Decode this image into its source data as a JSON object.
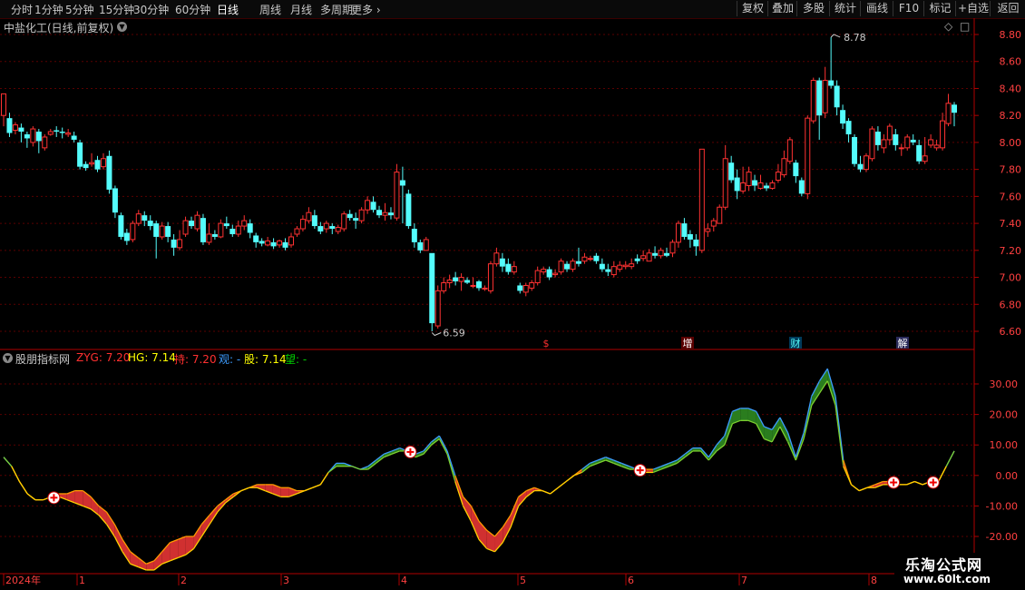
{
  "toolbar": {
    "tabs": [
      "分时",
      "1分钟",
      "5分钟",
      "15分钟",
      "30分钟",
      "60分钟",
      "日线",
      "周线",
      "月线",
      "多周期",
      "更多"
    ],
    "active_tab": "日线",
    "buttons": [
      "复权",
      "叠加",
      "多股",
      "统计",
      "画线",
      "F10",
      "标记",
      "+自选",
      "返回"
    ]
  },
  "main_title": "中盐化工(日线,前复权)",
  "indicator": {
    "name": "股朋指标网",
    "fields": [
      {
        "label": "ZYG: 7.20",
        "color": "#ff3030"
      },
      {
        "label": "HG: 7.14",
        "color": "#ffff00"
      },
      {
        "label": "持: 7.20",
        "color": "#ff3030"
      },
      {
        "label": "观: -",
        "color": "#3c9cff"
      },
      {
        "label": "股: 7.14",
        "color": "#ffff00"
      },
      {
        "label": "望: -",
        "color": "#00d000"
      }
    ]
  },
  "price_axis": [
    "8.80",
    "8.60",
    "8.40",
    "8.20",
    "8.00",
    "7.80",
    "7.60",
    "7.40",
    "7.20",
    "7.00",
    "6.80",
    "6.60"
  ],
  "ind_axis": [
    "30.00",
    "20.00",
    "10.00",
    "0.00",
    "-10.00",
    "-20.00"
  ],
  "annotations": {
    "high": "8.78",
    "low": "6.59"
  },
  "events": [
    "$",
    "增",
    "财",
    "解"
  ],
  "time_axis": [
    "2024年",
    "1",
    "2",
    "3",
    "4",
    "5",
    "6",
    "7",
    "8"
  ],
  "watermark": {
    "line1": "乐淘公式网",
    "line2": "www.60lt.com"
  },
  "colors": {
    "up": "#ff3232",
    "down": "#54fcfc",
    "grid": "#5a0000",
    "axis": "#b00000"
  },
  "chart_data": [
    {
      "type": "candlestick",
      "ylim": [
        6.55,
        8.85
      ],
      "candles": [
        [
          8.2,
          8.36,
          8.36,
          8.12
        ],
        [
          8.18,
          8.07,
          8.22,
          8.04
        ],
        [
          8.09,
          8.13,
          8.15,
          8.06
        ],
        [
          8.11,
          8.08,
          8.14,
          8.0
        ],
        [
          8.06,
          8.03,
          8.08,
          7.96
        ],
        [
          8.0,
          8.1,
          8.12,
          7.97
        ],
        [
          8.08,
          8.01,
          8.1,
          7.92
        ],
        [
          7.96,
          8.04,
          8.06,
          7.94
        ],
        [
          8.06,
          8.08,
          8.1,
          8.05
        ],
        [
          8.09,
          8.08,
          8.12,
          8.04
        ],
        [
          8.08,
          8.07,
          8.11,
          8.03
        ],
        [
          8.06,
          8.07,
          8.1,
          8.04
        ],
        [
          8.05,
          8.02,
          8.08,
          8.0
        ],
        [
          8.0,
          7.82,
          8.02,
          7.8
        ],
        [
          7.84,
          7.81,
          7.86,
          7.79
        ],
        [
          7.84,
          7.85,
          7.92,
          7.82
        ],
        [
          7.87,
          7.8,
          7.9,
          7.78
        ],
        [
          7.82,
          7.88,
          7.92,
          7.8
        ],
        [
          7.9,
          7.65,
          7.94,
          7.62
        ],
        [
          7.66,
          7.48,
          7.68,
          7.44
        ],
        [
          7.46,
          7.3,
          7.48,
          7.28
        ],
        [
          7.33,
          7.27,
          7.36,
          7.24
        ],
        [
          7.28,
          7.4,
          7.42,
          7.26
        ],
        [
          7.4,
          7.47,
          7.5,
          7.38
        ],
        [
          7.46,
          7.42,
          7.49,
          7.38
        ],
        [
          7.42,
          7.38,
          7.46,
          7.35
        ],
        [
          7.4,
          7.3,
          7.42,
          7.14
        ],
        [
          7.3,
          7.38,
          7.41,
          7.28
        ],
        [
          7.38,
          7.3,
          7.41,
          7.26
        ],
        [
          7.28,
          7.22,
          7.32,
          7.16
        ],
        [
          7.22,
          7.28,
          7.35,
          7.2
        ],
        [
          7.32,
          7.42,
          7.45,
          7.3
        ],
        [
          7.42,
          7.38,
          7.45,
          7.36
        ],
        [
          7.36,
          7.46,
          7.49,
          7.34
        ],
        [
          7.44,
          7.26,
          7.47,
          7.24
        ],
        [
          7.26,
          7.32,
          7.4,
          7.24
        ],
        [
          7.32,
          7.3,
          7.35,
          7.28
        ],
        [
          7.3,
          7.4,
          7.43,
          7.29
        ],
        [
          7.4,
          7.38,
          7.45,
          7.36
        ],
        [
          7.36,
          7.32,
          7.39,
          7.3
        ],
        [
          7.32,
          7.38,
          7.42,
          7.3
        ],
        [
          7.38,
          7.42,
          7.46,
          7.35
        ],
        [
          7.4,
          7.33,
          7.43,
          7.29
        ],
        [
          7.31,
          7.26,
          7.33,
          7.22
        ],
        [
          7.27,
          7.25,
          7.29,
          7.23
        ],
        [
          7.24,
          7.27,
          7.3,
          7.23
        ],
        [
          7.26,
          7.23,
          7.29,
          7.21
        ],
        [
          7.24,
          7.27,
          7.28,
          7.22
        ],
        [
          7.26,
          7.22,
          7.29,
          7.2
        ],
        [
          7.24,
          7.3,
          7.33,
          7.22
        ],
        [
          7.32,
          7.36,
          7.38,
          7.3
        ],
        [
          7.36,
          7.43,
          7.46,
          7.34
        ],
        [
          7.42,
          7.48,
          7.52,
          7.4
        ],
        [
          7.46,
          7.38,
          7.5,
          7.36
        ],
        [
          7.38,
          7.34,
          7.41,
          7.32
        ],
        [
          7.36,
          7.4,
          7.42,
          7.33
        ],
        [
          7.38,
          7.36,
          7.4,
          7.32
        ],
        [
          7.34,
          7.37,
          7.39,
          7.32
        ],
        [
          7.36,
          7.47,
          7.49,
          7.34
        ],
        [
          7.47,
          7.44,
          7.5,
          7.42
        ],
        [
          7.44,
          7.42,
          7.48,
          7.36
        ],
        [
          7.42,
          7.5,
          7.52,
          7.4
        ],
        [
          7.5,
          7.57,
          7.6,
          7.47
        ],
        [
          7.56,
          7.5,
          7.6,
          7.48
        ],
        [
          7.5,
          7.46,
          7.53,
          7.44
        ],
        [
          7.46,
          7.48,
          7.55,
          7.42
        ],
        [
          7.48,
          7.46,
          7.52,
          7.43
        ],
        [
          7.44,
          7.78,
          7.84,
          7.42
        ],
        [
          7.72,
          7.68,
          7.82,
          7.4
        ],
        [
          7.62,
          7.38,
          7.65,
          7.36
        ],
        [
          7.36,
          7.26,
          7.4,
          7.22
        ],
        [
          7.26,
          7.2,
          7.28,
          7.18
        ],
        [
          7.2,
          7.28,
          7.3,
          7.22
        ],
        [
          7.18,
          6.66,
          7.16,
          6.6
        ],
        [
          6.64,
          6.9,
          6.94,
          6.62
        ],
        [
          6.9,
          6.96,
          7.0,
          6.88
        ],
        [
          6.96,
          6.98,
          7.02,
          6.92
        ],
        [
          7.0,
          6.97,
          7.04,
          6.94
        ],
        [
          6.97,
          7.0,
          7.03,
          6.9
        ],
        [
          6.98,
          6.96,
          7.0,
          6.95
        ],
        [
          6.94,
          6.94,
          7.0,
          6.92
        ],
        [
          6.97,
          6.92,
          6.98,
          6.9
        ],
        [
          6.92,
          6.92,
          6.94,
          6.9
        ],
        [
          6.9,
          7.1,
          7.12,
          6.88
        ],
        [
          7.1,
          7.18,
          7.22,
          7.08
        ],
        [
          7.14,
          7.08,
          7.18,
          7.04
        ],
        [
          7.1,
          7.04,
          7.14,
          7.02
        ],
        [
          7.04,
          7.08,
          7.12,
          7.02
        ],
        [
          6.94,
          6.9,
          6.96,
          6.88
        ],
        [
          6.89,
          6.94,
          6.96,
          6.86
        ],
        [
          6.92,
          6.96,
          6.98,
          6.9
        ],
        [
          6.96,
          7.05,
          7.08,
          6.94
        ],
        [
          7.04,
          7.06,
          7.08,
          7.02
        ],
        [
          7.06,
          7.0,
          7.08,
          6.98
        ],
        [
          7.02,
          7.03,
          7.06,
          7.0
        ],
        [
          7.04,
          7.12,
          7.14,
          7.02
        ],
        [
          7.1,
          7.06,
          7.12,
          7.04
        ],
        [
          7.06,
          7.12,
          7.14,
          7.04
        ],
        [
          7.12,
          7.1,
          7.22,
          7.08
        ],
        [
          7.12,
          7.15,
          7.18,
          7.1
        ],
        [
          7.14,
          7.14,
          7.16,
          7.12
        ],
        [
          7.16,
          7.12,
          7.18,
          7.1
        ],
        [
          7.1,
          7.06,
          7.14,
          7.04
        ],
        [
          7.06,
          7.04,
          7.1,
          7.01
        ],
        [
          7.02,
          7.08,
          7.12,
          7.0
        ],
        [
          7.06,
          7.09,
          7.12,
          7.04
        ],
        [
          7.08,
          7.09,
          7.12,
          7.06
        ],
        [
          7.08,
          7.1,
          7.14,
          7.06
        ],
        [
          7.14,
          7.12,
          7.17,
          7.1
        ],
        [
          7.14,
          7.16,
          7.2,
          7.12
        ],
        [
          7.12,
          7.18,
          7.21,
          7.12
        ],
        [
          7.18,
          7.16,
          7.23,
          7.14
        ],
        [
          7.16,
          7.2,
          7.22,
          7.14
        ],
        [
          7.18,
          7.16,
          7.22,
          7.15
        ],
        [
          7.18,
          7.26,
          7.28,
          7.15
        ],
        [
          7.26,
          7.4,
          7.42,
          7.22
        ],
        [
          7.4,
          7.3,
          7.44,
          7.28
        ],
        [
          7.32,
          7.28,
          7.35,
          7.22
        ],
        [
          7.28,
          7.23,
          7.32,
          7.16
        ],
        [
          7.2,
          7.95,
          7.95,
          7.18
        ],
        [
          7.34,
          7.36,
          7.4,
          7.3
        ],
        [
          7.38,
          7.42,
          7.44,
          7.34
        ],
        [
          7.4,
          7.52,
          7.54,
          7.4
        ],
        [
          7.52,
          7.88,
          7.98,
          7.5
        ],
        [
          7.85,
          7.72,
          7.9,
          7.7
        ],
        [
          7.74,
          7.64,
          7.8,
          7.58
        ],
        [
          7.64,
          7.7,
          7.82,
          7.62
        ],
        [
          7.68,
          7.78,
          7.82,
          7.64
        ],
        [
          7.72,
          7.68,
          7.76,
          7.64
        ],
        [
          7.66,
          7.7,
          7.76,
          7.65
        ],
        [
          7.68,
          7.66,
          7.7,
          7.64
        ],
        [
          7.66,
          7.7,
          7.72,
          7.65
        ],
        [
          7.72,
          7.78,
          7.84,
          7.7
        ],
        [
          7.76,
          7.88,
          7.94,
          7.74
        ],
        [
          7.86,
          8.02,
          8.04,
          7.84
        ],
        [
          7.85,
          7.75,
          7.87,
          7.7
        ],
        [
          7.72,
          7.62,
          7.74,
          7.6
        ],
        [
          7.62,
          8.18,
          8.2,
          7.58
        ],
        [
          8.16,
          8.46,
          8.48,
          8.14
        ],
        [
          8.46,
          8.2,
          8.48,
          8.02
        ],
        [
          8.22,
          8.46,
          8.56,
          8.18
        ],
        [
          8.46,
          8.42,
          8.78,
          8.4
        ],
        [
          8.42,
          8.26,
          8.46,
          8.2
        ],
        [
          8.24,
          8.14,
          8.28,
          8.1
        ],
        [
          8.16,
          8.06,
          8.18,
          8.0
        ],
        [
          8.04,
          7.84,
          8.06,
          7.82
        ],
        [
          7.84,
          7.8,
          7.9,
          7.78
        ],
        [
          7.8,
          7.9,
          7.92,
          7.78
        ],
        [
          7.88,
          8.1,
          8.12,
          7.86
        ],
        [
          8.08,
          7.98,
          8.12,
          7.94
        ],
        [
          7.96,
          8.02,
          8.06,
          7.92
        ],
        [
          8.02,
          8.12,
          8.14,
          7.98
        ],
        [
          8.06,
          7.98,
          8.1,
          7.94
        ],
        [
          7.96,
          7.96,
          7.99,
          7.9
        ],
        [
          7.96,
          8.04,
          8.06,
          7.94
        ],
        [
          8.02,
          8.0,
          8.06,
          7.98
        ],
        [
          7.98,
          7.86,
          8.02,
          7.84
        ],
        [
          7.86,
          7.9,
          8.04,
          7.84
        ],
        [
          7.98,
          8.02,
          8.06,
          7.96
        ],
        [
          7.96,
          7.98,
          8.02,
          7.94
        ],
        [
          7.96,
          8.16,
          8.22,
          7.94
        ],
        [
          8.14,
          8.29,
          8.36,
          8.12
        ],
        [
          8.28,
          8.22,
          8.3,
          8.12
        ]
      ]
    },
    {
      "type": "area",
      "title": "股朋指标网",
      "ylim": [
        -32,
        40
      ],
      "series": [
        {
          "name": "upper",
          "values": [
            6,
            3,
            -2,
            -6,
            -8,
            -8,
            -7,
            -6,
            -6,
            -5,
            -5,
            -7,
            -10,
            -12,
            -16,
            -21,
            -25,
            -27,
            -29,
            -28,
            -25,
            -22,
            -21,
            -20,
            -20,
            -16,
            -13,
            -10,
            -8,
            -6,
            -5,
            -4,
            -3,
            -3,
            -3,
            -4,
            -4,
            -5,
            -5,
            -4,
            -3,
            1,
            4,
            4,
            3,
            2,
            3,
            5,
            7,
            8,
            9,
            8,
            7,
            8,
            11,
            13,
            8,
            0,
            -7,
            -10,
            -15,
            -18,
            -20,
            -17,
            -13,
            -7,
            -5,
            -4,
            -5,
            -6,
            -4,
            -2,
            0,
            2,
            4,
            5,
            6,
            5,
            4,
            3,
            2,
            2,
            2,
            3,
            4,
            5,
            7,
            9,
            9,
            6,
            10,
            13,
            21,
            22,
            22,
            21,
            16,
            15,
            19,
            14,
            6,
            14,
            26,
            31,
            35,
            26,
            5,
            -3,
            -5,
            -4,
            -3,
            -2,
            -2,
            -3,
            -3,
            -2,
            -3,
            -2,
            -2,
            3,
            8
          ]
        },
        {
          "name": "lower",
          "values": [
            6,
            3,
            -2,
            -6,
            -8,
            -8,
            -7,
            -7,
            -8,
            -9,
            -10,
            -11,
            -13,
            -16,
            -20,
            -25,
            -29,
            -30,
            -31,
            -31,
            -29,
            -28,
            -27,
            -26,
            -24,
            -20,
            -16,
            -12,
            -9,
            -7,
            -5,
            -4,
            -4,
            -5,
            -6,
            -7,
            -7,
            -6,
            -5,
            -4,
            -3,
            1,
            3,
            3,
            3,
            2,
            2,
            4,
            6,
            7,
            8,
            8,
            6,
            7,
            10,
            12,
            7,
            -2,
            -10,
            -15,
            -21,
            -24,
            -25,
            -22,
            -17,
            -10,
            -7,
            -5,
            -5,
            -6,
            -4,
            -2,
            0,
            1,
            3,
            4,
            5,
            4,
            3,
            2,
            2,
            1,
            1,
            2,
            3,
            4,
            6,
            8,
            8,
            5,
            8,
            10,
            17,
            18,
            18,
            17,
            12,
            11,
            16,
            11,
            5,
            12,
            23,
            27,
            31,
            23,
            3,
            -3,
            -5,
            -4,
            -4,
            -3,
            -3,
            -3,
            -3,
            -2,
            -3,
            -2,
            -2,
            3,
            8
          ]
        }
      ],
      "markers_index": [
        6,
        51,
        80,
        112,
        117
      ]
    }
  ]
}
